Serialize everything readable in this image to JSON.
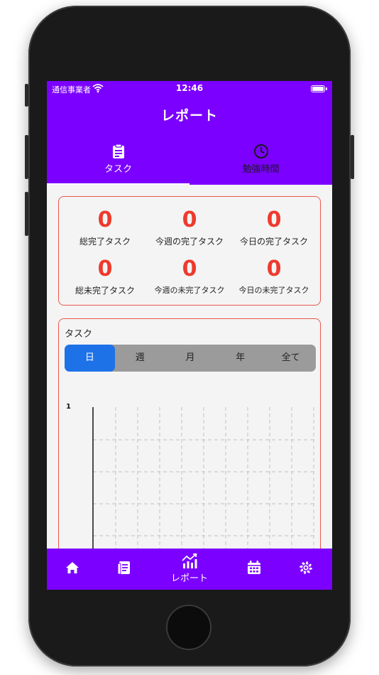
{
  "status_bar": {
    "carrier": "通信事業者",
    "time": "12:46"
  },
  "header": {
    "title": "レポート"
  },
  "tabs": [
    {
      "label": "タスク",
      "icon": "clipboard-icon",
      "active": true
    },
    {
      "label": "勉強時間",
      "icon": "clock-icon",
      "active": false
    }
  ],
  "summary": [
    {
      "value": "0",
      "label": "総完了タスク"
    },
    {
      "value": "0",
      "label": "今週の完了タスク"
    },
    {
      "value": "0",
      "label": "今日の完了タスク"
    },
    {
      "value": "0",
      "label": "総未完了タスク"
    },
    {
      "value": "0",
      "label": "今週の未完了タスク"
    },
    {
      "value": "0",
      "label": "今日の未完了タスク"
    }
  ],
  "task_chart": {
    "title": "タスク",
    "periods": [
      "日",
      "週",
      "月",
      "年",
      "全て"
    ],
    "selected_period": "日"
  },
  "chart_data": {
    "type": "bar",
    "title": "",
    "xlabel": "",
    "ylabel": "",
    "y_tick_labels": [
      "1"
    ],
    "ylim": [
      0,
      1
    ],
    "grid": true,
    "series": []
  },
  "bottom_nav": [
    {
      "icon": "home-icon",
      "label": ""
    },
    {
      "icon": "document-icon",
      "label": ""
    },
    {
      "icon": "chart-icon",
      "label": "レポート",
      "active": true
    },
    {
      "icon": "calendar-icon",
      "label": ""
    },
    {
      "icon": "gear-icon",
      "label": ""
    }
  ],
  "colors": {
    "primary": "#7b00ff",
    "accent_red": "#ee3a2e",
    "segment_active": "#1e72e8",
    "segment_bg": "#9b9b9b"
  }
}
